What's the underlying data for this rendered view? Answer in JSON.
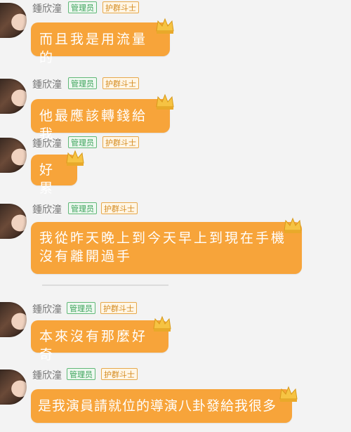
{
  "messages": [
    {
      "name": "鍾欣潼",
      "badges": [
        "管理员",
        "护群斗士"
      ],
      "text": "而且我是用流量的"
    },
    {
      "name": "鍾欣潼",
      "badges": [
        "管理员",
        "护群斗士"
      ],
      "text": "他最應該轉錢給我"
    },
    {
      "name": "鍾欣潼",
      "badges": [
        "管理员",
        "护群斗士"
      ],
      "text": "好累"
    },
    {
      "name": "鍾欣潼",
      "badges": [
        "管理员",
        "护群斗士"
      ],
      "text": "我從昨天晚上到今天早上到現在手機沒有離開過手"
    },
    {
      "name": "鍾欣潼",
      "badges": [
        "管理员",
        "护群斗士"
      ],
      "text": "本來沒有那麼好奇"
    },
    {
      "name": "鍾欣潼",
      "badges": [
        "管理员",
        "护群斗士"
      ],
      "text": "是我演員請就位的導演八卦發給我很多"
    }
  ],
  "colors": {
    "bubble": "#f7a43a",
    "admin_badge": "#3ba35a",
    "fighter_badge": "#d58b1f",
    "background": "#f3f3f3"
  },
  "icons": [
    "avatar",
    "crown-icon"
  ]
}
